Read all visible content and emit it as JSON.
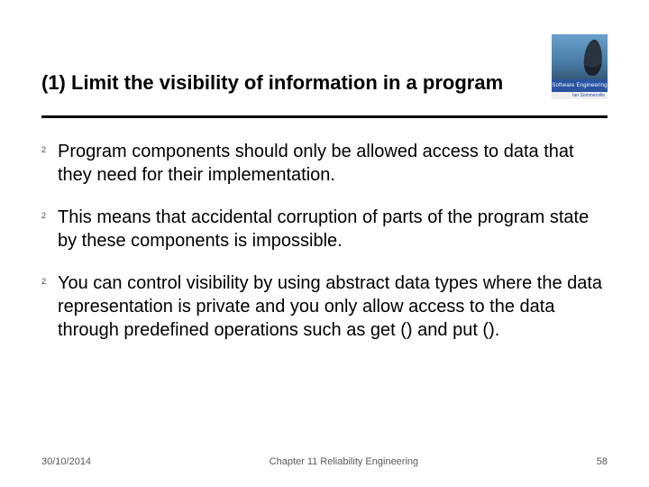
{
  "title": "(1) Limit the visibility of information in a program",
  "logo": {
    "band": "Software Engineering",
    "sub": "Ian Sommerville"
  },
  "bullets": [
    "Program components should only be allowed access to data that they need for their implementation.",
    "This means that accidental corruption of parts of the program state by these components is impossible.",
    "You can control visibility by using abstract data types where the data representation is private and you only allow access to the data through predefined operations such as get () and put ()."
  ],
  "footer": {
    "date": "30/10/2014",
    "chapter": "Chapter 11 Reliability Engineering",
    "page": "58"
  }
}
